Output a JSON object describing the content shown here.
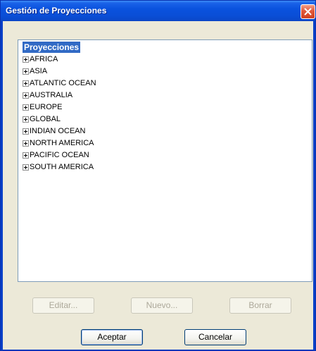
{
  "window": {
    "title": "Gestión de Proyecciones"
  },
  "tree": {
    "root_label": "Proyecciones",
    "items": [
      {
        "label": "AFRICA"
      },
      {
        "label": "ASIA"
      },
      {
        "label": "ATLANTIC OCEAN"
      },
      {
        "label": "AUSTRALIA"
      },
      {
        "label": "EUROPE"
      },
      {
        "label": "GLOBAL"
      },
      {
        "label": "INDIAN OCEAN"
      },
      {
        "label": "NORTH AMERICA"
      },
      {
        "label": "PACIFIC OCEAN"
      },
      {
        "label": "SOUTH AMERICA"
      }
    ]
  },
  "actions": {
    "edit_label": "Editar...",
    "new_label": "Nuevo...",
    "delete_label": "Borrar"
  },
  "footer": {
    "accept_label": "Aceptar",
    "cancel_label": "Cancelar"
  },
  "colors": {
    "titlebar": "#0a52de",
    "selection": "#316ac5",
    "dialog_bg": "#ece9d8",
    "close_button": "#e2593a"
  },
  "icons": {
    "close": "close-icon",
    "expand": "plus-box-icon"
  }
}
